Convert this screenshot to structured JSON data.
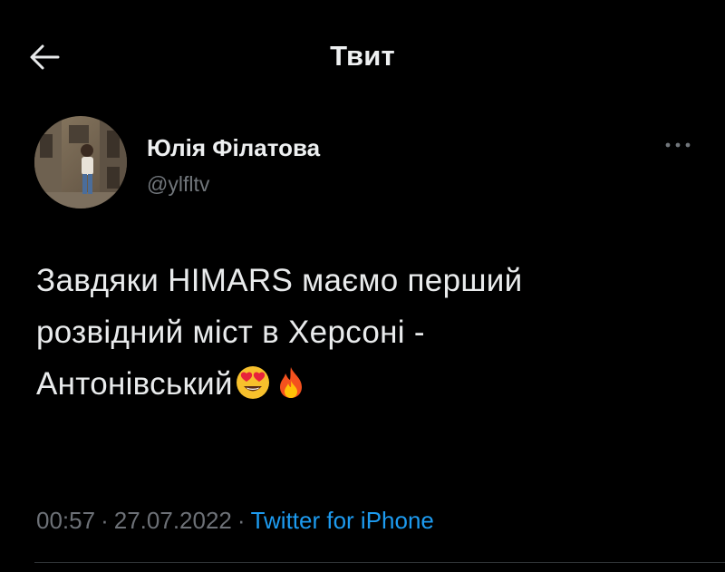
{
  "header": {
    "title": "Твит",
    "back_icon": "arrow-left-icon"
  },
  "author": {
    "display_name": "Юлія Філатова",
    "handle": "@ylfltv",
    "more_icon": "more-horizontal-icon"
  },
  "tweet": {
    "lines": [
      "Завдяки HIMARS маємо перший",
      "розвідний міст в Херсоні -",
      "Антонівський"
    ],
    "emojis": [
      "smiling-face-with-heart-eyes-icon",
      "fire-icon"
    ]
  },
  "meta": {
    "time": "00:57",
    "separator": "·",
    "date": "27.07.2022",
    "source": "Twitter for iPhone"
  },
  "colors": {
    "background": "#000000",
    "text": "#e7e9ea",
    "secondary": "#71767b",
    "accent": "#1d9bf0"
  }
}
